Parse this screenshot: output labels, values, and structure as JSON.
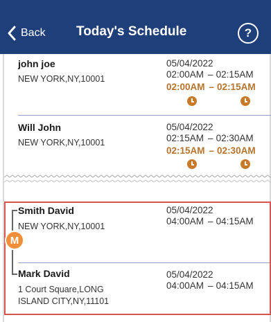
{
  "header": {
    "back_label": "Back",
    "title": "Today's Schedule",
    "help_label": "?"
  },
  "schedule": [
    {
      "name": "john joe",
      "address": "NEW YORK,NY,10001",
      "date": "05/04/2022",
      "start": "02:00AM",
      "end": "02:15AM",
      "actual_start": "02:00AM",
      "actual_end": "02:15AM"
    },
    {
      "name": "Will John",
      "address": "NEW YORK,NY,10001",
      "date": "05/04/2022",
      "start": "02:15AM",
      "end": "02:30AM",
      "actual_start": "02:15AM",
      "actual_end": "02:30AM"
    }
  ],
  "merged_group": {
    "badge": "M",
    "items": [
      {
        "name": "Smith David",
        "address": "NEW YORK,NY,10001",
        "date": "05/04/2022",
        "start": "04:00AM",
        "end": "04:15AM"
      },
      {
        "name": "Mark David",
        "address_line1": "1 Court Square,LONG",
        "address_line2": "ISLAND CITY,NY,11101",
        "date": "05/04/2022",
        "start": "04:00AM",
        "end": "04:15AM"
      }
    ]
  },
  "dash": "–",
  "colors": {
    "header_bg": "#1f3f7a",
    "actual_time": "#b7722b",
    "merged_border": "#d9534f",
    "merged_badge": "#ef8f3a"
  }
}
